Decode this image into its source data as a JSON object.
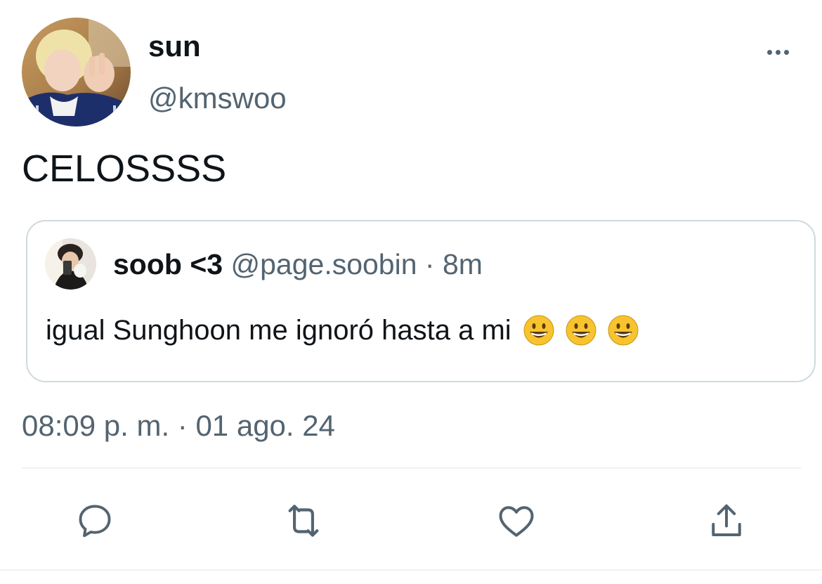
{
  "author": {
    "display_name": "sun",
    "handle": "@kmswoo"
  },
  "tweet": {
    "text": "CELOSSSS",
    "timestamp": "08:09 p. m. · 01 ago. 24"
  },
  "quoted_tweet": {
    "display_name": "soob <3",
    "meta": "@page.soobin · 8m",
    "text": "igual Sunghoon me ignoró hasta a mi",
    "emojis": [
      "grinning-face",
      "grinning-face",
      "grinning-face"
    ]
  },
  "actions": [
    "reply-icon",
    "retweet-icon",
    "like-icon",
    "share-icon"
  ],
  "colors": {
    "text_primary": "#0f1419",
    "text_secondary": "#536471",
    "border": "#cfd9de",
    "icon": "#536471"
  }
}
